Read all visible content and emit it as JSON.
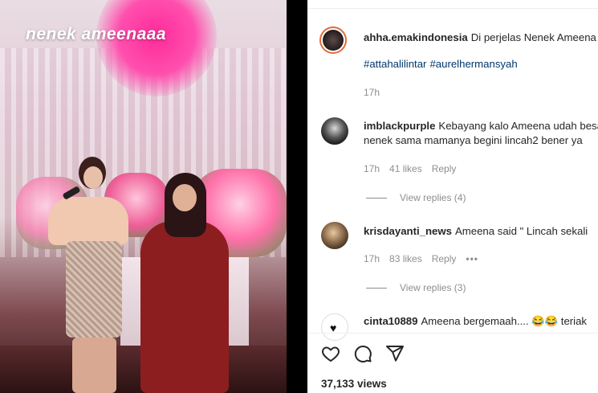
{
  "media": {
    "caption": "nenek ameenaaa"
  },
  "post": {
    "author": "ahha.emakindonesia",
    "text": "Di perjelas Nenek Ameena",
    "hashtags": [
      "#attahalilintar",
      "#aurelhermansyah"
    ],
    "time": "17h"
  },
  "comments": [
    {
      "user": "imblackpurple",
      "text_line1": "Kebayang kalo Ameena udah besar, liat",
      "text_line2": "nenek sama mamanya begini lincah2 bener ya",
      "time": "17h",
      "likes": "41 likes",
      "reply": "Reply",
      "view_replies": "View replies (4)"
    },
    {
      "user": "krisdayanti_news",
      "text_line1": "Ameena said \" Lincah sekali",
      "time": "17h",
      "likes": "83 likes",
      "reply": "Reply",
      "more": "•••",
      "view_replies": "View replies (3)"
    },
    {
      "user": "cinta10889",
      "text_line1": "Ameena bergemaah.... 😂😂 teriak"
    }
  ],
  "footer": {
    "views": "37,133 views"
  },
  "icons": {
    "like": "heart-icon",
    "comment": "comment-icon",
    "share": "share-icon"
  }
}
